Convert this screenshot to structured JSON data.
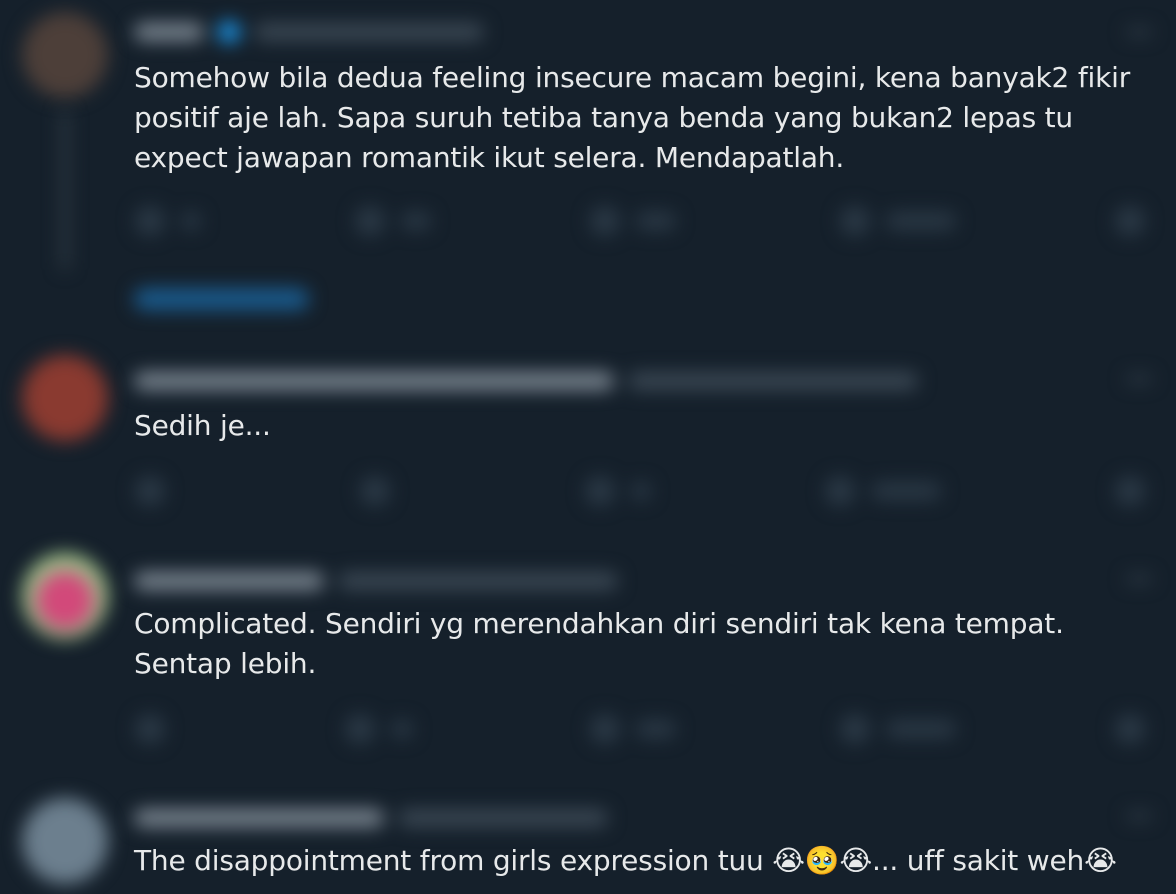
{
  "replies": [
    {
      "text": "Somehow bila dedua feeling insecure macam begini, kena banyak2 fikir positif aje lah. Sapa suruh tetiba tanya benda yang bukan2 lepas tu expect jawapan romantik ikut selera. Mendapatlah.",
      "avatar_color": "#5a4a42"
    },
    {
      "text": "Sedih je...",
      "avatar_color": "#8a3a30"
    },
    {
      "text": "Complicated. Sendiri yg merendahkan diri sendiri tak kena tempat. Sentap lebih.",
      "avatar_color": "#d2497a"
    },
    {
      "text_before": "The disappointment from girls expression tuu ",
      "emoji_group": "😭🥹😭",
      "text_after": "... uff sakit weh",
      "emoji_end": "😭",
      "avatar_color": "#6c7f8e"
    }
  ],
  "colors": {
    "background": "#15202b",
    "text": "#e7e9ea",
    "accent": "#1d9bf0"
  }
}
